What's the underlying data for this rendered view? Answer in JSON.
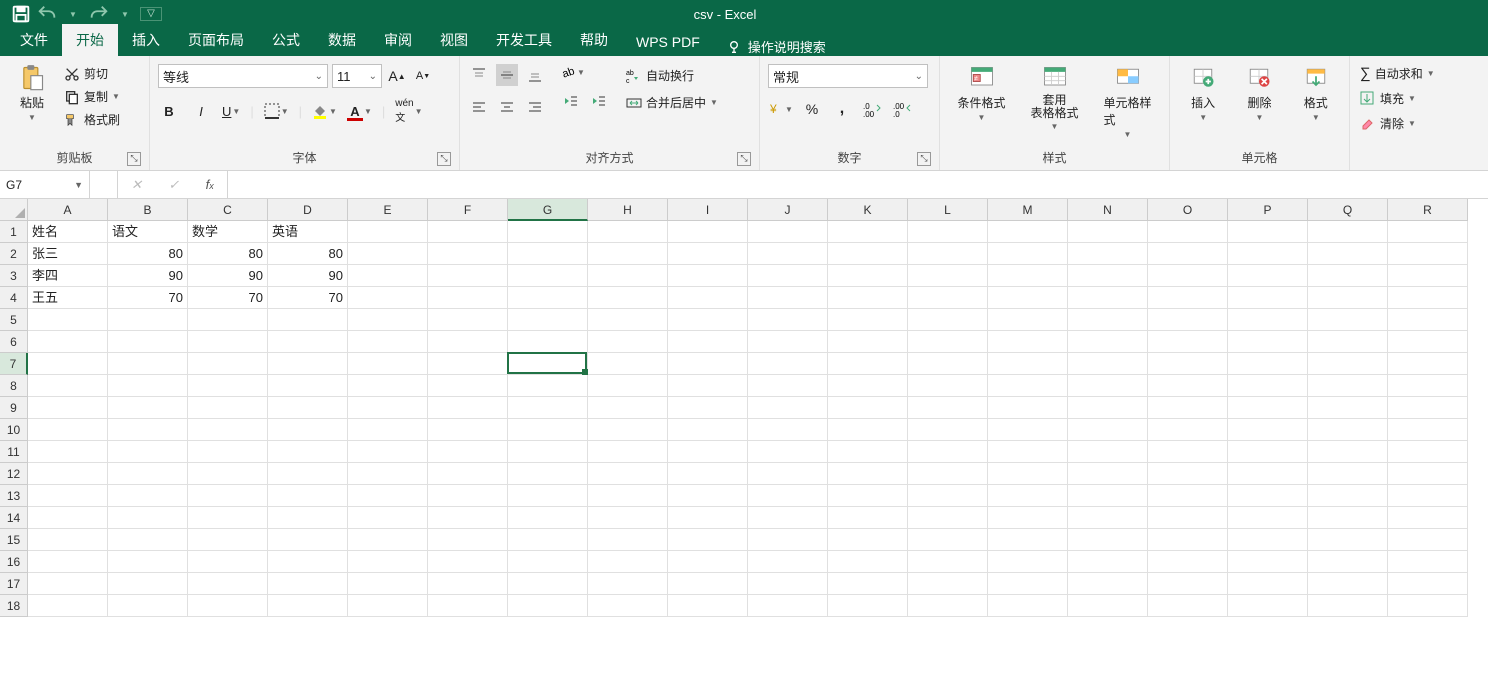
{
  "title": "csv  -  Excel",
  "qat": {
    "save": "保存",
    "undo": "撤销",
    "redo": "重做"
  },
  "tabs": [
    "文件",
    "开始",
    "插入",
    "页面布局",
    "公式",
    "数据",
    "审阅",
    "视图",
    "开发工具",
    "帮助",
    "WPS PDF"
  ],
  "active_tab_index": 1,
  "tell_me": "操作说明搜索",
  "ribbon": {
    "clipboard": {
      "paste": "粘贴",
      "cut": "剪切",
      "copy": "复制",
      "format_painter": "格式刷",
      "title": "剪贴板"
    },
    "font": {
      "name": "等线",
      "size": "11",
      "title": "字体"
    },
    "alignment": {
      "wrap": "自动换行",
      "merge": "合并后居中",
      "title": "对齐方式"
    },
    "number": {
      "format": "常规",
      "title": "数字"
    },
    "styles": {
      "cond": "条件格式",
      "table_fmt": "套用\n表格格式",
      "cell_styles": "单元格样式",
      "title": "样式"
    },
    "cells": {
      "insert": "插入",
      "delete": "删除",
      "format": "格式",
      "title": "单元格"
    },
    "editing": {
      "autosum": "自动求和",
      "fill": "填充",
      "clear": "清除"
    }
  },
  "namebox": "G7",
  "columns": [
    "A",
    "B",
    "C",
    "D",
    "E",
    "F",
    "G",
    "H",
    "I",
    "J",
    "K",
    "L",
    "M",
    "N",
    "O",
    "P",
    "Q",
    "R"
  ],
  "active_col_index": 6,
  "total_rows": 18,
  "active_row_index": 6,
  "data": [
    [
      "姓名",
      "语文",
      "数学",
      "英语"
    ],
    [
      "张三",
      "80",
      "80",
      "80"
    ],
    [
      "李四",
      "90",
      "90",
      "90"
    ],
    [
      "王五",
      "70",
      "70",
      "70"
    ]
  ],
  "numeric_from_col": 1
}
